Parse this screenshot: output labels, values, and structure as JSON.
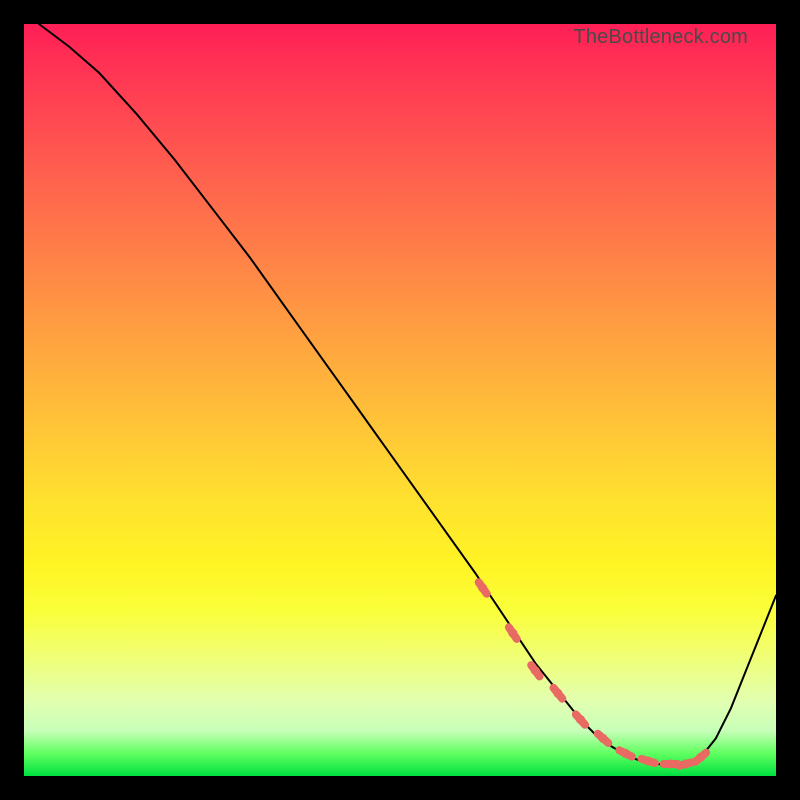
{
  "watermark": "TheBottleneck.com",
  "colors": {
    "curve": "#000000",
    "marker": "#e96a63",
    "border": "#000000"
  },
  "chart_data": {
    "type": "line",
    "title": "",
    "xlabel": "",
    "ylabel": "",
    "xlim": [
      0,
      100
    ],
    "ylim": [
      0,
      100
    ],
    "series": [
      {
        "name": "bottleneck-curve",
        "x": [
          2,
          6,
          10,
          15,
          20,
          25,
          30,
          35,
          40,
          45,
          50,
          55,
          60,
          62,
          64,
          66,
          68,
          70,
          72,
          74,
          76,
          78,
          80,
          82,
          84,
          86,
          88,
          90,
          92,
          94,
          96,
          98,
          100
        ],
        "y": [
          100,
          97,
          93.5,
          88,
          82,
          75.5,
          69,
          62,
          55,
          48,
          41,
          34,
          27,
          24,
          21,
          18,
          15,
          12.5,
          10,
          7.5,
          5.5,
          4,
          2.8,
          2,
          1.6,
          1.5,
          1.6,
          2.5,
          5,
          9,
          14,
          19,
          24
        ]
      }
    ],
    "markers": {
      "name": "highlight-region",
      "x": [
        61,
        65,
        68,
        71,
        74,
        77,
        80,
        83,
        86,
        88,
        90
      ],
      "y": [
        25,
        19,
        14,
        11,
        7.5,
        5,
        3,
        2,
        1.6,
        1.6,
        2.5
      ]
    }
  }
}
